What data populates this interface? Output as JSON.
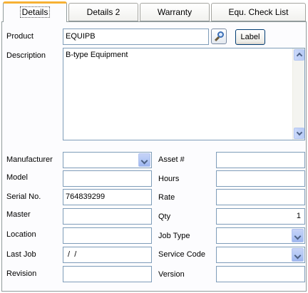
{
  "tabs": [
    {
      "label": "Details",
      "active": true
    },
    {
      "label": "Details 2",
      "active": false
    },
    {
      "label": "Warranty",
      "active": false
    },
    {
      "label": "Equ. Check List",
      "active": false
    }
  ],
  "product": {
    "label": "Product",
    "value": "EQUIPB",
    "search_icon": "magnifier-icon",
    "label_button": "Label"
  },
  "description": {
    "label": "Description",
    "value": "B-type Equipment"
  },
  "left_fields": {
    "manufacturer": {
      "label": "Manufacturer",
      "value": ""
    },
    "model": {
      "label": "Model",
      "value": ""
    },
    "serial_no": {
      "label": "Serial No.",
      "value": "764839299"
    },
    "master": {
      "label": "Master",
      "value": ""
    },
    "location": {
      "label": "Location",
      "value": ""
    },
    "last_job": {
      "label": "Last Job",
      "value": " /  /"
    },
    "revision": {
      "label": "Revision",
      "value": ""
    }
  },
  "right_fields": {
    "asset_no": {
      "label": "Asset #",
      "value": ""
    },
    "hours": {
      "label": "Hours",
      "value": ""
    },
    "rate": {
      "label": "Rate",
      "value": ""
    },
    "qty": {
      "label": "Qty",
      "value": "1"
    },
    "job_type": {
      "label": "Job Type",
      "value": ""
    },
    "service_code": {
      "label": "Service Code",
      "value": ""
    },
    "version": {
      "label": "Version",
      "value": ""
    }
  },
  "colors": {
    "active_tab_accent": "#f7b134",
    "field_border": "#7f9db9",
    "dropdown_button": "#b4c8f5"
  }
}
